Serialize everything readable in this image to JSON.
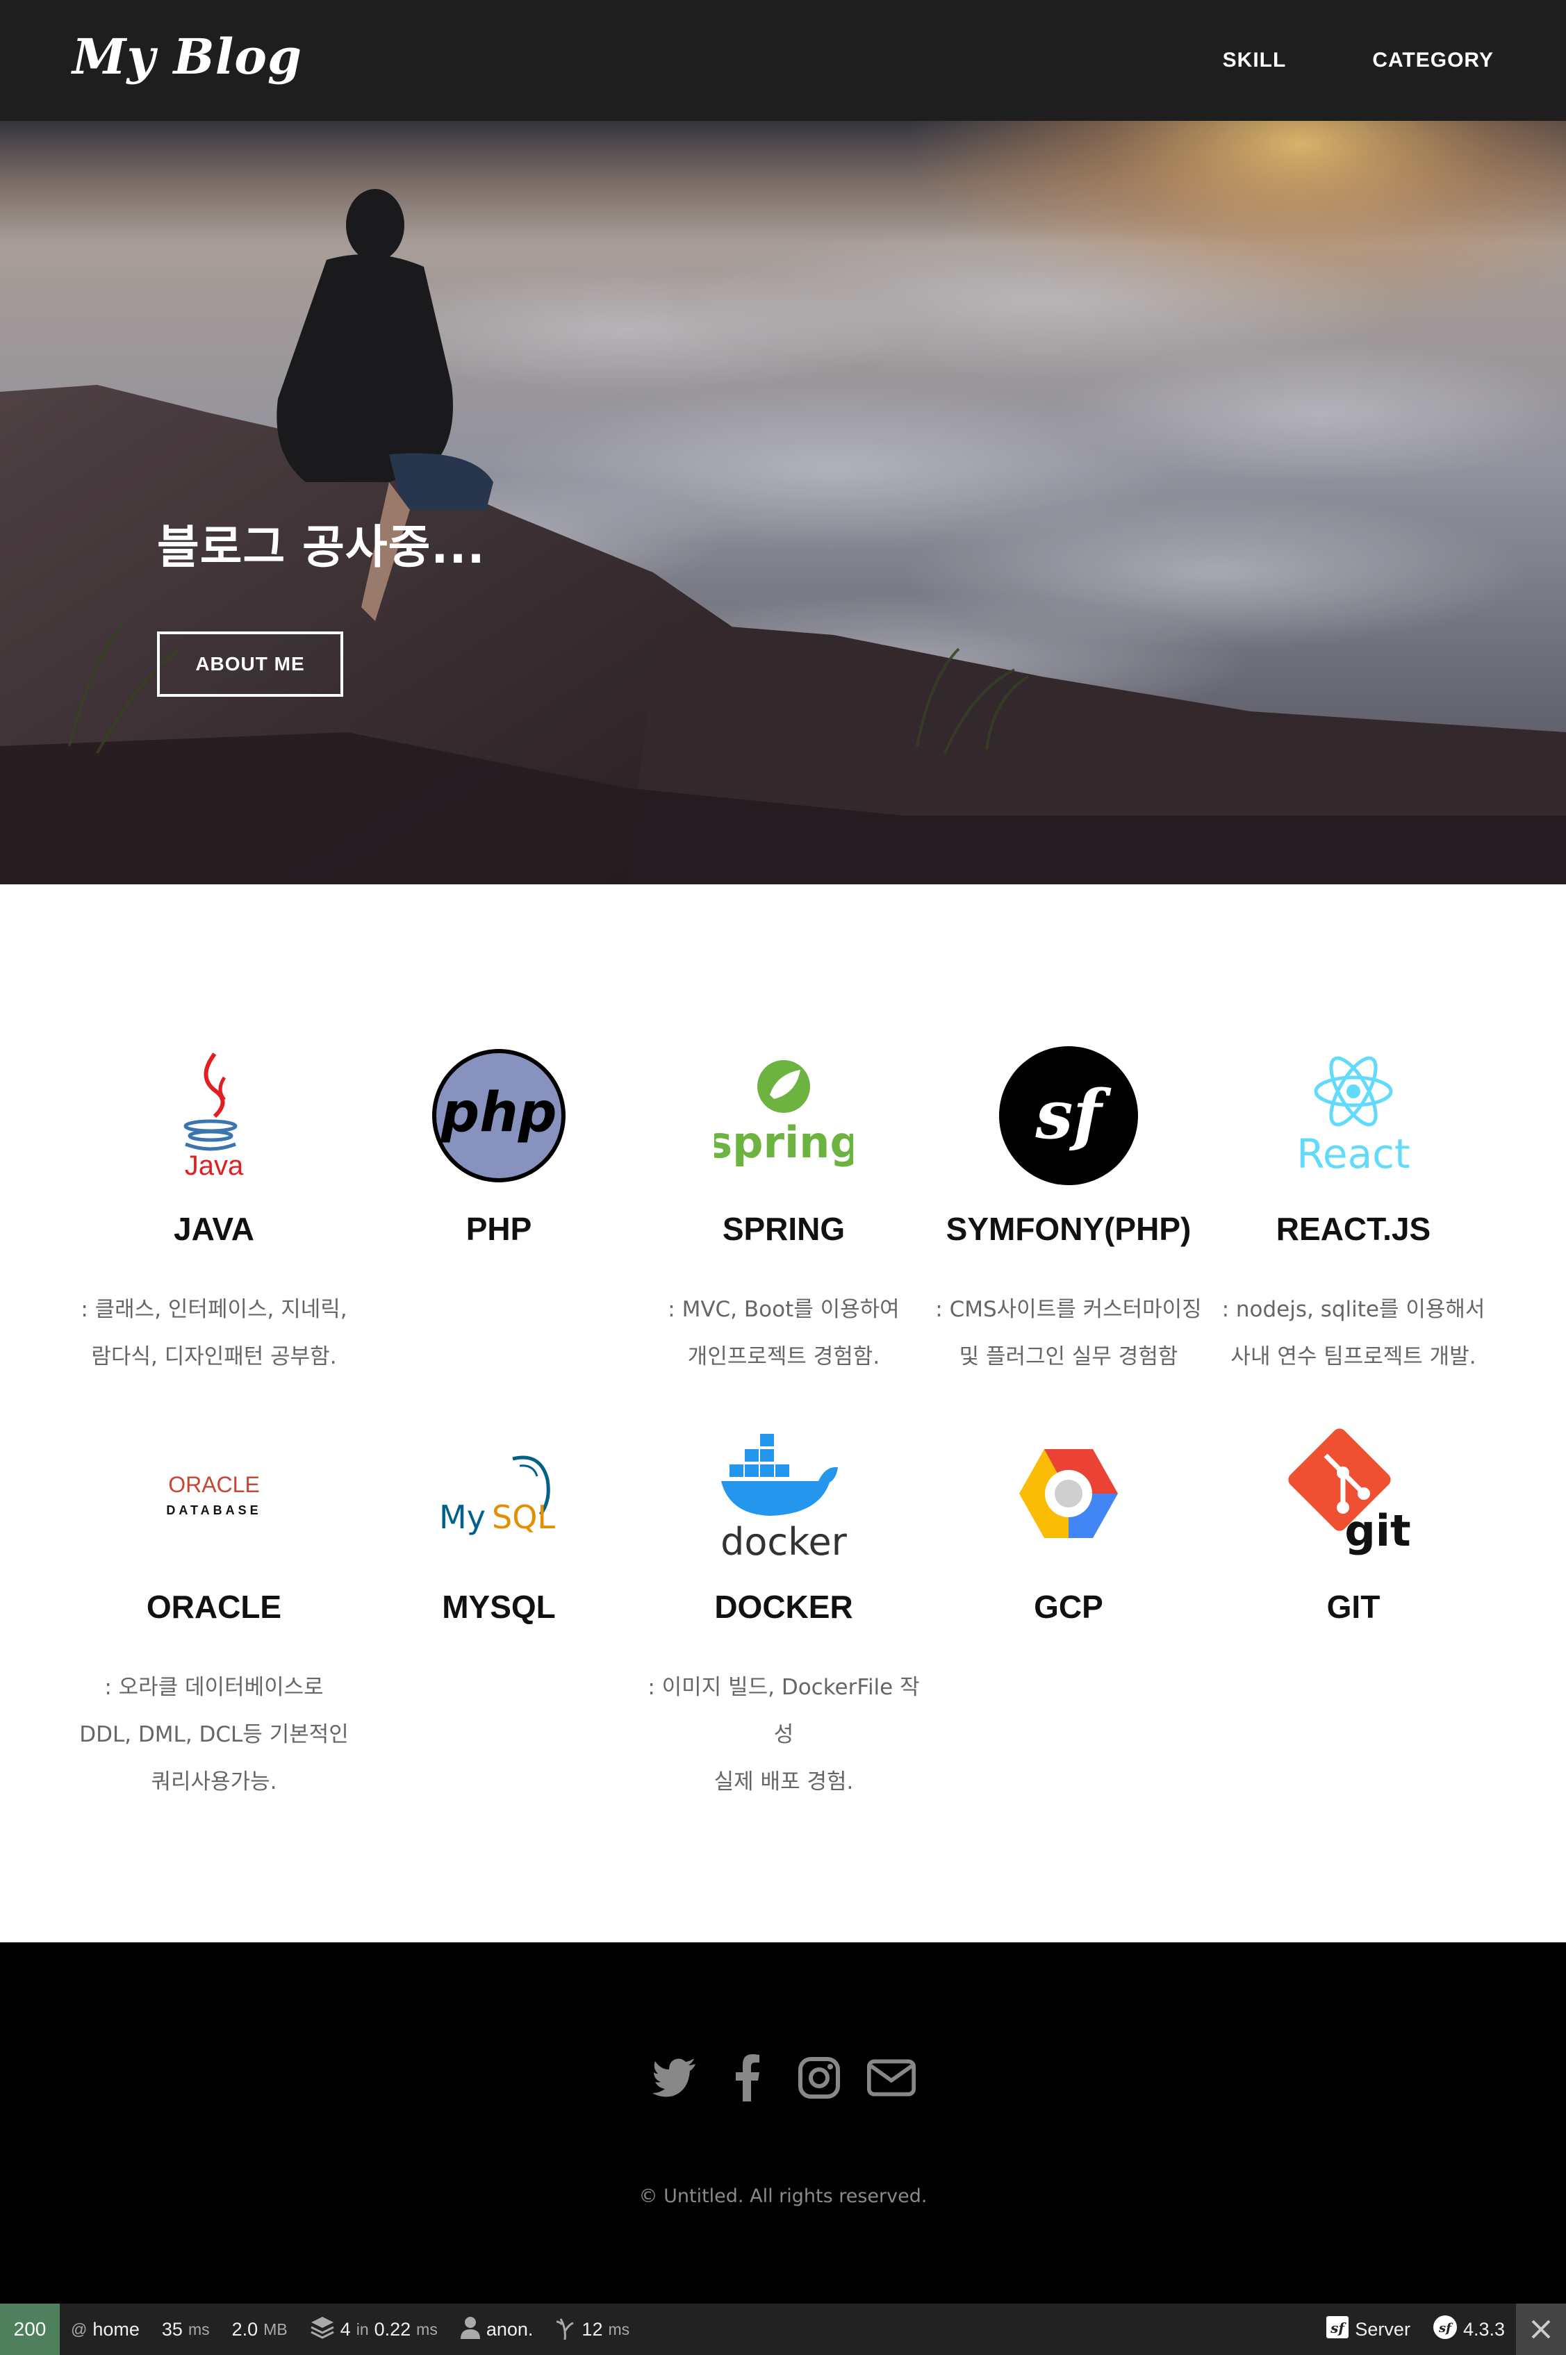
{
  "header": {
    "logo": "My Blog",
    "nav": [
      "SKILL",
      "CATEGORY"
    ]
  },
  "hero": {
    "title": "블로그 공사중...",
    "button": "ABOUT ME"
  },
  "skills": [
    {
      "name": "JAVA",
      "logo": "java-logo",
      "logo_text": "Java",
      "desc": [
        ": 클래스, 인터페이스, 지네릭,",
        "람다식, 디자인패턴 공부함."
      ]
    },
    {
      "name": "PHP",
      "logo": "php-logo",
      "logo_text": "php",
      "desc": []
    },
    {
      "name": "SPRING",
      "logo": "spring-logo",
      "logo_text": "spring",
      "desc": [
        ": MVC, Boot를 이용하여",
        "개인프로젝트 경험함."
      ]
    },
    {
      "name": "SYMFONY(PHP)",
      "logo": "symfony-logo",
      "logo_text": "sf",
      "desc": [
        ": CMS사이트를 커스터마이징",
        "및 플러그인 실무 경험함"
      ]
    },
    {
      "name": "REACT.JS",
      "logo": "react-logo",
      "logo_text": "React",
      "desc": [
        ": nodejs, sqlite를 이용해서",
        "사내 연수 팀프로젝트 개발."
      ]
    },
    {
      "name": "ORACLE",
      "logo": "oracle-logo",
      "logo_text": "ORACLE",
      "logo_sub": "DATABASE",
      "desc": [
        ": 오라클 데이터베이스로",
        "DDL, DML, DCL등 기본적인",
        "쿼리사용가능."
      ]
    },
    {
      "name": "MYSQL",
      "logo": "mysql-logo",
      "logo_text": "MySQL",
      "desc": []
    },
    {
      "name": "DOCKER",
      "logo": "docker-logo",
      "logo_text": "docker",
      "desc": [
        ": 이미지 빌드, DockerFile 작",
        "성",
        "실제 배포 경험."
      ]
    },
    {
      "name": "GCP",
      "logo": "gcp-logo",
      "desc": []
    },
    {
      "name": "GIT",
      "logo": "git-logo",
      "logo_text": "git",
      "desc": []
    }
  ],
  "footer": {
    "social": [
      "twitter-icon",
      "facebook-icon",
      "instagram-icon",
      "envelope-icon"
    ],
    "copyright": "© Untitled. All rights reserved."
  },
  "toolbar": {
    "status": "200",
    "route": "home",
    "time": "35",
    "time_unit": "ms",
    "memory": "2.0",
    "memory_unit": "MB",
    "db_queries": "4",
    "db_in": "in",
    "db_time": "0.22",
    "db_unit": "ms",
    "user": "anon.",
    "twig_time": "12",
    "twig_unit": "ms",
    "server": "Server",
    "version": "4.3.3"
  },
  "colors": {
    "header_bg": "#1e1e1e",
    "footer_bg": "#000000",
    "toolbar_bg": "#222222",
    "status_ok": "#4f805d",
    "java_red": "#e11f21",
    "java_blue": "#3a75b0",
    "php_purple": "#8892bf",
    "spring_green": "#6db33f",
    "react_cyan": "#61dafb",
    "oracle_red": "#c74634",
    "mysql_blue": "#00618a",
    "mysql_orange": "#e48e00",
    "docker_blue": "#2496ed",
    "git_red": "#f05032"
  }
}
